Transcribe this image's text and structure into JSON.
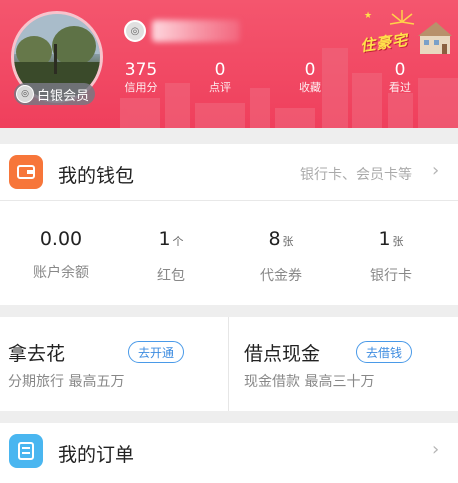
{
  "header": {
    "vip_label": "白银会员",
    "stats": [
      {
        "value": "375",
        "label": "信用分"
      },
      {
        "value": "0",
        "label": "点评"
      },
      {
        "value": "0",
        "label": "收藏"
      },
      {
        "value": "0",
        "label": "看过"
      }
    ],
    "promo_text": "住豪宅",
    "colors": {
      "primary": "#ef3f5c",
      "accent_blue": "#3d8ce0",
      "wallet_icon": "#f7763a",
      "orders_icon": "#4ab6f0"
    }
  },
  "wallet": {
    "title": "我的钱包",
    "subtitle": "银行卡、会员卡等",
    "stats": [
      {
        "value": "0.00",
        "unit": "",
        "label": "账户余额"
      },
      {
        "value": "1",
        "unit": "个",
        "label": "红包"
      },
      {
        "value": "8",
        "unit": "张",
        "label": "代金券"
      },
      {
        "value": "1",
        "unit": "张",
        "label": "银行卡"
      }
    ]
  },
  "services": [
    {
      "title": "拿去花",
      "button": "去开通",
      "subtitle": "分期旅行 最高五万"
    },
    {
      "title": "借点现金",
      "button": "去借钱",
      "subtitle": "现金借款 最高三十万"
    }
  ],
  "orders": {
    "title": "我的订单"
  },
  "icons": {
    "wallet": "wallet-icon",
    "orders": "order-list-icon",
    "chevron": "chevron-right-icon"
  }
}
